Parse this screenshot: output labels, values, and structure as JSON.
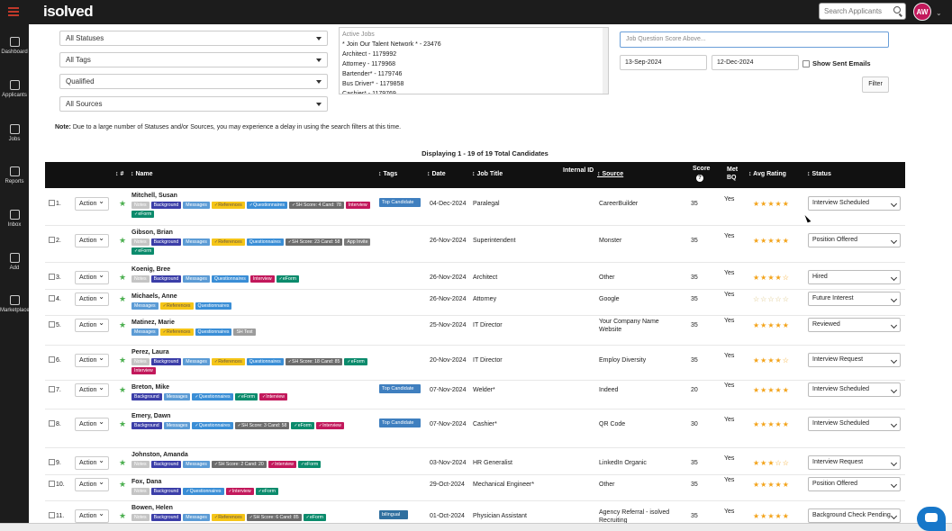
{
  "app": {
    "logo": "isolved",
    "search_placeholder": "Search Applicants",
    "avatar": "AW"
  },
  "nav": [
    {
      "label": "Dashboard",
      "icon": "dashboard-icon"
    },
    {
      "label": "Applicants",
      "icon": "applicants-icon"
    },
    {
      "label": "Jobs",
      "icon": "jobs-icon"
    },
    {
      "label": "Reports",
      "icon": "reports-icon"
    },
    {
      "label": "Inbox",
      "icon": "inbox-icon"
    },
    {
      "label": "Add",
      "icon": "add-icon"
    },
    {
      "label": "Marketplace",
      "icon": "marketplace-icon"
    }
  ],
  "filters": {
    "statuses": "All Statuses",
    "tags": "All Tags",
    "qualified": "Qualified",
    "sources": "All Sources",
    "jobs_header": "Active Jobs",
    "jobs": [
      "* Join Our Talent Network * - 23476",
      "Architect - 1179992",
      "Attorney - 1179968",
      "Bartender* - 1179746",
      "Bus Driver* - 1179858",
      "Cashier* - 1179769"
    ],
    "score_placeholder": "Job Question Score Above...",
    "date_from": "13-Sep-2024",
    "date_to": "12-Dec-2024",
    "show_sent": "Show Sent Emails",
    "filter_btn": "Filter"
  },
  "note_label": "Note:",
  "note_text": " Due to a large number of Statuses and/or Sources, you may experience a delay in using the search filters at this time.",
  "displaying": "Displaying 1 - 19 of 19 Total Candidates",
  "columns": {
    "sort": "↕ #",
    "name": "↕ Name",
    "tags": "↕ Tags",
    "date": "↕ Date",
    "job": "↕ Job Title",
    "internal": "Internal ID",
    "source": "↕ Source",
    "score": "Score",
    "met": "Met BQ",
    "rating": "↕ Avg Rating",
    "status": "↕ Status"
  },
  "score_icon": "?",
  "action_label": "Action",
  "rows": [
    {
      "num": "1.",
      "name": "Mitchell, Susan",
      "tags": [
        [
          "Notes",
          "notes"
        ],
        [
          "Background",
          "background"
        ],
        [
          "Messages",
          "messages"
        ],
        [
          "✓References",
          "references"
        ],
        [
          "✓Questionnaires",
          "questionnaires"
        ],
        [
          "✓SH Score: 4 Cand: 78",
          "sh"
        ],
        [
          "Interview",
          "interview"
        ],
        [
          "✓eForm",
          "eform"
        ]
      ],
      "tag": "Top Candidate",
      "date": "04-Dec-2024",
      "job": "Paralegal",
      "source": "CareerBuilder",
      "score": "35",
      "met": "Yes",
      "rating": 4.5,
      "status": "Interview Scheduled"
    },
    {
      "num": "2.",
      "name": "Gibson, Brian",
      "tags": [
        [
          "Notes",
          "notes"
        ],
        [
          "Background",
          "background"
        ],
        [
          "Messages",
          "messages"
        ],
        [
          "✓References",
          "references"
        ],
        [
          "Questionnaires",
          "questionnaires"
        ],
        [
          "✓SH Score: 23 Cand: 58",
          "sh"
        ],
        [
          "App Invite",
          "applink"
        ],
        [
          "✓eForm",
          "eform"
        ]
      ],
      "tag": "",
      "date": "26-Nov-2024",
      "job": "Superintendent",
      "source": "Monster",
      "score": "35",
      "met": "Yes",
      "rating": 4.5,
      "status": "Position Offered"
    },
    {
      "num": "3.",
      "name": "Koenig, Bree",
      "tags": [
        [
          "Notes",
          "notes"
        ],
        [
          "Background",
          "background"
        ],
        [
          "Messages",
          "messages"
        ],
        [
          "Questionnaires",
          "questionnaires"
        ],
        [
          "Interview",
          "interview"
        ],
        [
          "✓eForm",
          "eform"
        ]
      ],
      "tag": "",
      "date": "26-Nov-2024",
      "job": "Architect",
      "source": "Other",
      "score": "35",
      "met": "Yes",
      "rating": 4,
      "status": "Hired"
    },
    {
      "num": "4.",
      "name": "Michaels, Anne",
      "tags": [
        [
          "Messages",
          "messages"
        ],
        [
          "✓References",
          "references"
        ],
        [
          "Questionnaires",
          "questionnaires"
        ]
      ],
      "tag": "",
      "date": "26-Nov-2024",
      "job": "Attorney",
      "source": "Google",
      "score": "35",
      "met": "Yes",
      "rating": 0,
      "status": "Future Interest"
    },
    {
      "num": "5.",
      "name": "Matinez, Marie",
      "tags": [
        [
          "Messages",
          "messages"
        ],
        [
          "✓References",
          "references"
        ],
        [
          "Questionnaires",
          "questionnaires"
        ],
        [
          "SH Test",
          "shtest"
        ]
      ],
      "tag": "",
      "date": "25-Nov-2024",
      "job": "IT Director",
      "source": "Your Company Name Website",
      "score": "35",
      "met": "Yes",
      "rating": 5,
      "status": "Reviewed"
    },
    {
      "num": "6.",
      "name": "Perez, Laura",
      "tags": [
        [
          "Notes",
          "notes"
        ],
        [
          "Background",
          "background"
        ],
        [
          "Messages",
          "messages"
        ],
        [
          "✓References",
          "references"
        ],
        [
          "Questionnaires",
          "questionnaires"
        ],
        [
          "✓SH Score: 18 Cand: 85",
          "sh"
        ],
        [
          "✓eForm",
          "eform"
        ],
        [
          "Interview",
          "interview"
        ]
      ],
      "tag": "",
      "date": "20-Nov-2024",
      "job": "IT Director",
      "source": "Employ Diversity",
      "score": "35",
      "met": "Yes",
      "rating": 4,
      "status": "Interview Request"
    },
    {
      "num": "7.",
      "name": "Breton, Mike",
      "tags": [
        [
          "Background",
          "background"
        ],
        [
          "Messages",
          "messages"
        ],
        [
          "✓Questionnaires",
          "questionnaires"
        ],
        [
          "✓eForm",
          "eform"
        ],
        [
          "✓Interview",
          "interview"
        ]
      ],
      "tag": "Top Candidate",
      "date": "07-Nov-2024",
      "job": "Welder*",
      "source": "Indeed",
      "score": "20",
      "met": "Yes",
      "rating": 5,
      "status": "Interview Scheduled"
    },
    {
      "num": "8.",
      "name": "Emery, Dawn",
      "tags": [
        [
          "Background",
          "background"
        ],
        [
          "Messages",
          "messages"
        ],
        [
          "✓Questionnaires",
          "questionnaires"
        ],
        [
          "✓SH Score: 3 Cand: 58",
          "sh"
        ],
        [
          "✓eForm",
          "eform"
        ],
        [
          "✓Interview",
          "interview"
        ]
      ],
      "tag": "Top Candidate",
      "date": "07-Nov-2024",
      "job": "Cashier*",
      "source": "QR Code",
      "score": "30",
      "met": "Yes",
      "rating": 5,
      "status": "Interview Scheduled"
    },
    {
      "num": "9.",
      "name": "Johnston, Amanda",
      "tags": [
        [
          "Notes",
          "notes"
        ],
        [
          "Background",
          "background"
        ],
        [
          "Messages",
          "messages"
        ],
        [
          "✓SH Score: 2 Cand: 20",
          "sh"
        ],
        [
          "✓Interview",
          "interview"
        ],
        [
          "✓eForm",
          "eform"
        ]
      ],
      "tag": "",
      "date": "03-Nov-2024",
      "job": "HR Generalist",
      "source": "LinkedIn Organic",
      "score": "35",
      "met": "Yes",
      "rating": 3,
      "status": "Interview Request"
    },
    {
      "num": "10.",
      "name": "Fox, Dana",
      "tags": [
        [
          "Notes",
          "notes"
        ],
        [
          "Background",
          "background"
        ],
        [
          "✓Questionnaires",
          "questionnaires"
        ],
        [
          "✓Interview",
          "interview"
        ],
        [
          "✓eForm",
          "eform"
        ]
      ],
      "tag": "",
      "date": "29-Oct-2024",
      "job": "Mechanical Engineer*",
      "source": "Other",
      "score": "35",
      "met": "Yes",
      "rating": 5,
      "status": "Position Offered"
    },
    {
      "num": "11.",
      "name": "Bowen, Helen",
      "tags": [
        [
          "Notes",
          "notes"
        ],
        [
          "Background",
          "background"
        ],
        [
          "Messages",
          "messages"
        ],
        [
          "✓References",
          "references"
        ],
        [
          "✓SH Score: 6 Cand: 85",
          "sh"
        ],
        [
          "✓eForm",
          "eform"
        ]
      ],
      "tag": "bilingual",
      "date": "01-Oct-2024",
      "job": "Physician Assistant",
      "source": "Agency Referral - isolved Recruiting",
      "score": "35",
      "met": "Yes",
      "rating": 5,
      "status": "Background Check Pending"
    }
  ]
}
